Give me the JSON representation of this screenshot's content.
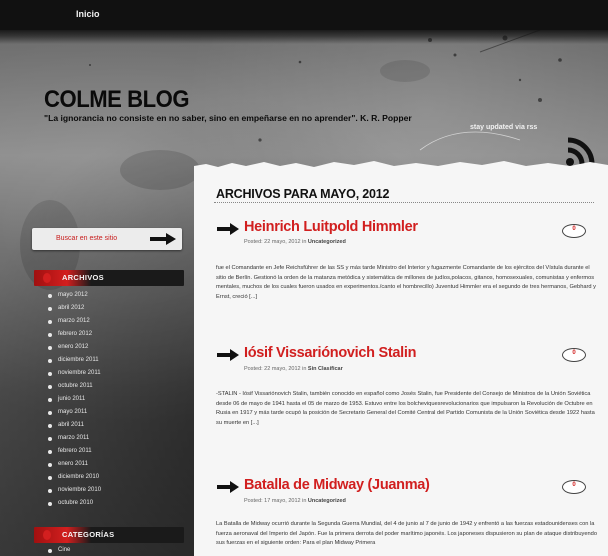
{
  "nav": {
    "items": [
      "Inicio"
    ]
  },
  "header": {
    "title": "COLME BLOG",
    "tagline": "\"La ignorancia no consiste en no saber, sino en empeñarse en no aprender\". K. R. Popper",
    "stay_updated": "stay updated via rss",
    "rss_icon": "rss-icon"
  },
  "sidebar": {
    "search_label": "Buscar en este sitio",
    "archives_title": "ARCHIVOS",
    "archives": [
      "mayo 2012",
      "abril 2012",
      "marzo 2012",
      "febrero 2012",
      "enero 2012",
      "diciembre 2011",
      "noviembre 2011",
      "octubre 2011",
      "junio 2011",
      "mayo 2011",
      "abril 2011",
      "marzo 2011",
      "febrero 2011",
      "enero 2011",
      "diciembre 2010",
      "noviembre 2010",
      "octubre 2010"
    ],
    "categories_title": "CATEGORÍAS",
    "categories": [
      "Cine"
    ]
  },
  "main": {
    "archive_heading": "ARCHIVOS PARA MAYO, 2012",
    "posts": [
      {
        "title": "Heinrich Luitpold Himmler",
        "meta_prefix": "Posted: 22 mayo, 2012 in ",
        "category": "Uncategorized",
        "comments": "0",
        "excerpt": "fue el Comandante en Jefe Reichsführer de las SS y más tarde Ministro del Interior y fugazmente Comandante de los ejércitos del Vístula durante el sitio de Berlín. Gestionó la orden de la matanza metódica y sistemática de millones de judíos,polacos, gitanos, homosexuales, comunistas y enfermos mentales, muchos de los cuales fueron usados en experimentos./canto el hombrecillo) Juventud  Himmler era el segundo de tres hermanos, Gebhard y Ernst, creció [...]"
      },
      {
        "title": "Iósif Vissariónovich Stalin",
        "meta_prefix": "Posted: 22 mayo, 2012 in ",
        "category": "Sin Clasificar",
        "comments": "0",
        "excerpt": "-STALIN -   Iósif Vissariónovich Stalin, también conocido en español como Josés Stalin, fue Presidente del Consejo de Ministros de la Unión Soviética desde 06 de mayo de 1941 hasta el 05 de marzo de 1953. Estuvo entre los bolcheviquesrevolucionarios que impulsaron la Revolución de Octubre en Rusia en 1917 y más tarde ocupó la posición de Secretario General del Comité Central del Partido Comunista de la Unión Soviética desde 1922 hasta su muerte en [...]"
      },
      {
        "title": "Batalla de Midway (Juanma)",
        "meta_prefix": "Posted: 17 mayo, 2012 in ",
        "category": "Uncategorized",
        "comments": "0",
        "excerpt": "La Batalla de Midway ocurrió durante la Segunda Guerra Mundial, del 4 de junio al 7 de junio de 1942 y enfrentó a las fuerzas estadounidenses con la fuerza aeronaval del Imperio del Japón. Fue la primera derrota del poder marítimo japonés. Los japoneses dispusieron su plan de ataque distribuyendo sus fuerzas en el siguiente orden: Para el plan Midway Primera"
      }
    ]
  },
  "colors": {
    "accent": "#d11f1f",
    "paper": "#f6f6f6",
    "nav_bg": "#111111"
  }
}
